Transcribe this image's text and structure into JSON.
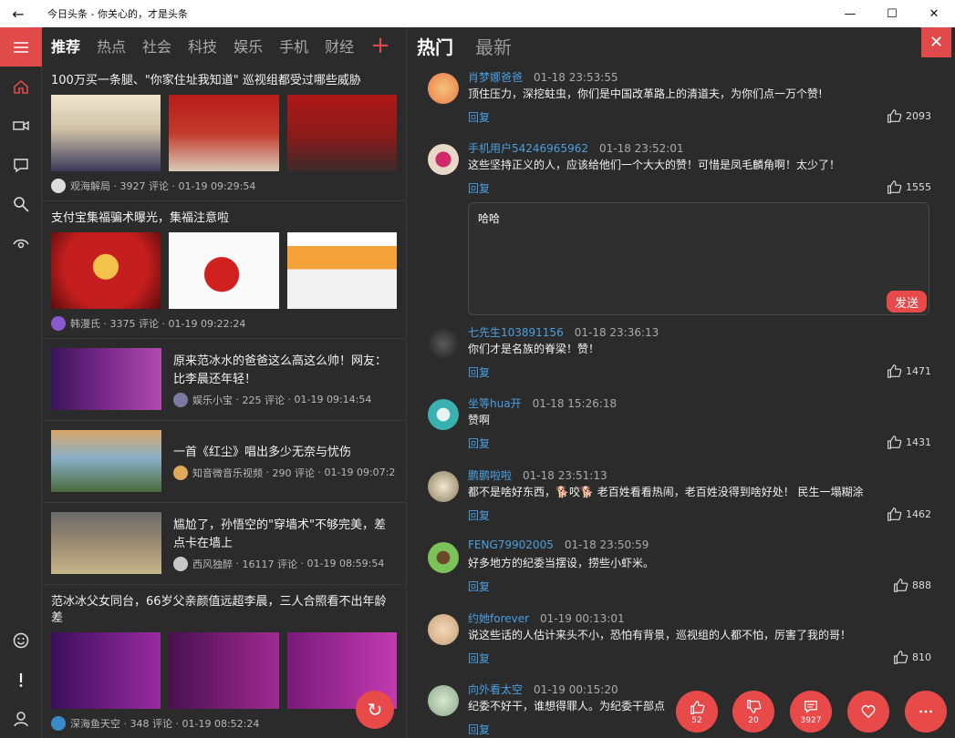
{
  "window": {
    "title": "今日头条 - 你关心的，才是头条"
  },
  "feed": {
    "tabs": [
      "推荐",
      "热点",
      "社会",
      "科技",
      "娱乐",
      "手机",
      "财经"
    ],
    "articles": [
      {
        "title": "100万买一条腿、\"你家住址我知道\" 巡视组都受过哪些威胁",
        "author": "观海解局",
        "comments": "3927 评论",
        "time": "01-19 09:29:54"
      },
      {
        "title": "支付宝集福骗术曝光，集福注意啦",
        "author": "韩漫氏",
        "comments": "3375 评论",
        "time": "01-19 09:22:24"
      },
      {
        "title": "原来范冰水的爸爸这么高这么帅！网友：比李晨还年轻！",
        "author": "娱乐小宝",
        "comments": "225 评论",
        "time": "01-19 09:14:54"
      },
      {
        "title": "一首《红尘》唱出多少无奈与忧伤",
        "author": "知音微音乐视频",
        "comments": "290 评论",
        "time": "01-19 09:07:2"
      },
      {
        "title": "尴尬了，孙悟空的\"穿墙术\"不够完美，差点卡在墙上",
        "author": "西风独醉",
        "comments": "16117 评论",
        "time": "01-19 08:59:54"
      },
      {
        "title": "范冰冰父女同台，66岁父亲颜值远超李晨，三人合照看不出年龄差",
        "author": "深海鱼天空",
        "comments": "348 评论",
        "time": "01-19 08:52:24"
      }
    ]
  },
  "panel": {
    "tabs": [
      "热门",
      "最新"
    ],
    "reply_label": "回复",
    "reply_box_text": "哈哈",
    "send_label": "发送",
    "comments": [
      {
        "user": "肖梦娜爸爸",
        "time": "01-18 23:53:55",
        "text": "顶住压力，深挖蛀虫，你们是中国改革路上的清道夫，为你们点一万个赞!",
        "likes": "2093"
      },
      {
        "user": "手机用户54246965962",
        "time": "01-18 23:52:01",
        "text": "这些坚持正义的人，应该给他们一个大大的赞！可惜是凤毛麟角啊！太少了！",
        "likes": "1555"
      },
      {
        "user": "七先生103891156",
        "time": "01-18 23:36:13",
        "text": "你们才是名族的脊梁！赞！",
        "likes": "1471"
      },
      {
        "user": "坐等hua开",
        "time": "01-18 15:26:18",
        "text": "赞啊",
        "likes": "1431"
      },
      {
        "user": "鹏鹏啦啦",
        "time": "01-18 23:51:13",
        "text": "都不是啥好东西，🐕咬🐕 老百姓看看热闹，老百姓没得到啥好处！ 民生一塌糊涂",
        "likes": "1462"
      },
      {
        "user": "FENG79902005",
        "time": "01-18 23:50:59",
        "text": "好多地方的纪委当摆设，捞些小虾米。",
        "likes": "888"
      },
      {
        "user": "约她forever",
        "time": "01-19 00:13:01",
        "text": "说这些话的人估计来头不小，恐怕有背景，巡视组的人都不怕，厉害了我的哥！",
        "likes": "810"
      },
      {
        "user": "向外看太空",
        "time": "01-19 00:15:20",
        "text": "纪委不好干，谁想得罪人。为纪委干部点",
        "likes": ""
      }
    ],
    "fab": {
      "like": "52",
      "dislike": "20",
      "comments": "3927"
    }
  },
  "colors": {
    "accent": "#e84a4a",
    "link": "#4a9fe0",
    "bg": "#2b2b2b"
  },
  "icons": [
    "menu-icon",
    "home-icon",
    "video-icon",
    "chat-icon",
    "search-icon",
    "eye-icon",
    "smiley-icon",
    "exclamation-icon",
    "user-icon",
    "close-icon",
    "thumb-up-icon",
    "thumb-down-icon",
    "heart-icon",
    "more-icon",
    "refresh-icon"
  ]
}
